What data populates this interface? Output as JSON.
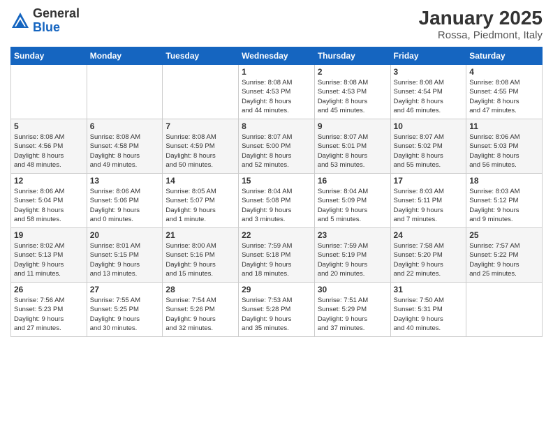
{
  "header": {
    "logo_general": "General",
    "logo_blue": "Blue",
    "title": "January 2025",
    "subtitle": "Rossa, Piedmont, Italy"
  },
  "weekdays": [
    "Sunday",
    "Monday",
    "Tuesday",
    "Wednesday",
    "Thursday",
    "Friday",
    "Saturday"
  ],
  "weeks": [
    [
      {
        "day": "",
        "info": ""
      },
      {
        "day": "",
        "info": ""
      },
      {
        "day": "",
        "info": ""
      },
      {
        "day": "1",
        "info": "Sunrise: 8:08 AM\nSunset: 4:53 PM\nDaylight: 8 hours\nand 44 minutes."
      },
      {
        "day": "2",
        "info": "Sunrise: 8:08 AM\nSunset: 4:53 PM\nDaylight: 8 hours\nand 45 minutes."
      },
      {
        "day": "3",
        "info": "Sunrise: 8:08 AM\nSunset: 4:54 PM\nDaylight: 8 hours\nand 46 minutes."
      },
      {
        "day": "4",
        "info": "Sunrise: 8:08 AM\nSunset: 4:55 PM\nDaylight: 8 hours\nand 47 minutes."
      }
    ],
    [
      {
        "day": "5",
        "info": "Sunrise: 8:08 AM\nSunset: 4:56 PM\nDaylight: 8 hours\nand 48 minutes."
      },
      {
        "day": "6",
        "info": "Sunrise: 8:08 AM\nSunset: 4:58 PM\nDaylight: 8 hours\nand 49 minutes."
      },
      {
        "day": "7",
        "info": "Sunrise: 8:08 AM\nSunset: 4:59 PM\nDaylight: 8 hours\nand 50 minutes."
      },
      {
        "day": "8",
        "info": "Sunrise: 8:07 AM\nSunset: 5:00 PM\nDaylight: 8 hours\nand 52 minutes."
      },
      {
        "day": "9",
        "info": "Sunrise: 8:07 AM\nSunset: 5:01 PM\nDaylight: 8 hours\nand 53 minutes."
      },
      {
        "day": "10",
        "info": "Sunrise: 8:07 AM\nSunset: 5:02 PM\nDaylight: 8 hours\nand 55 minutes."
      },
      {
        "day": "11",
        "info": "Sunrise: 8:06 AM\nSunset: 5:03 PM\nDaylight: 8 hours\nand 56 minutes."
      }
    ],
    [
      {
        "day": "12",
        "info": "Sunrise: 8:06 AM\nSunset: 5:04 PM\nDaylight: 8 hours\nand 58 minutes."
      },
      {
        "day": "13",
        "info": "Sunrise: 8:06 AM\nSunset: 5:06 PM\nDaylight: 9 hours\nand 0 minutes."
      },
      {
        "day": "14",
        "info": "Sunrise: 8:05 AM\nSunset: 5:07 PM\nDaylight: 9 hours\nand 1 minute."
      },
      {
        "day": "15",
        "info": "Sunrise: 8:04 AM\nSunset: 5:08 PM\nDaylight: 9 hours\nand 3 minutes."
      },
      {
        "day": "16",
        "info": "Sunrise: 8:04 AM\nSunset: 5:09 PM\nDaylight: 9 hours\nand 5 minutes."
      },
      {
        "day": "17",
        "info": "Sunrise: 8:03 AM\nSunset: 5:11 PM\nDaylight: 9 hours\nand 7 minutes."
      },
      {
        "day": "18",
        "info": "Sunrise: 8:03 AM\nSunset: 5:12 PM\nDaylight: 9 hours\nand 9 minutes."
      }
    ],
    [
      {
        "day": "19",
        "info": "Sunrise: 8:02 AM\nSunset: 5:13 PM\nDaylight: 9 hours\nand 11 minutes."
      },
      {
        "day": "20",
        "info": "Sunrise: 8:01 AM\nSunset: 5:15 PM\nDaylight: 9 hours\nand 13 minutes."
      },
      {
        "day": "21",
        "info": "Sunrise: 8:00 AM\nSunset: 5:16 PM\nDaylight: 9 hours\nand 15 minutes."
      },
      {
        "day": "22",
        "info": "Sunrise: 7:59 AM\nSunset: 5:18 PM\nDaylight: 9 hours\nand 18 minutes."
      },
      {
        "day": "23",
        "info": "Sunrise: 7:59 AM\nSunset: 5:19 PM\nDaylight: 9 hours\nand 20 minutes."
      },
      {
        "day": "24",
        "info": "Sunrise: 7:58 AM\nSunset: 5:20 PM\nDaylight: 9 hours\nand 22 minutes."
      },
      {
        "day": "25",
        "info": "Sunrise: 7:57 AM\nSunset: 5:22 PM\nDaylight: 9 hours\nand 25 minutes."
      }
    ],
    [
      {
        "day": "26",
        "info": "Sunrise: 7:56 AM\nSunset: 5:23 PM\nDaylight: 9 hours\nand 27 minutes."
      },
      {
        "day": "27",
        "info": "Sunrise: 7:55 AM\nSunset: 5:25 PM\nDaylight: 9 hours\nand 30 minutes."
      },
      {
        "day": "28",
        "info": "Sunrise: 7:54 AM\nSunset: 5:26 PM\nDaylight: 9 hours\nand 32 minutes."
      },
      {
        "day": "29",
        "info": "Sunrise: 7:53 AM\nSunset: 5:28 PM\nDaylight: 9 hours\nand 35 minutes."
      },
      {
        "day": "30",
        "info": "Sunrise: 7:51 AM\nSunset: 5:29 PM\nDaylight: 9 hours\nand 37 minutes."
      },
      {
        "day": "31",
        "info": "Sunrise: 7:50 AM\nSunset: 5:31 PM\nDaylight: 9 hours\nand 40 minutes."
      },
      {
        "day": "",
        "info": ""
      }
    ]
  ]
}
